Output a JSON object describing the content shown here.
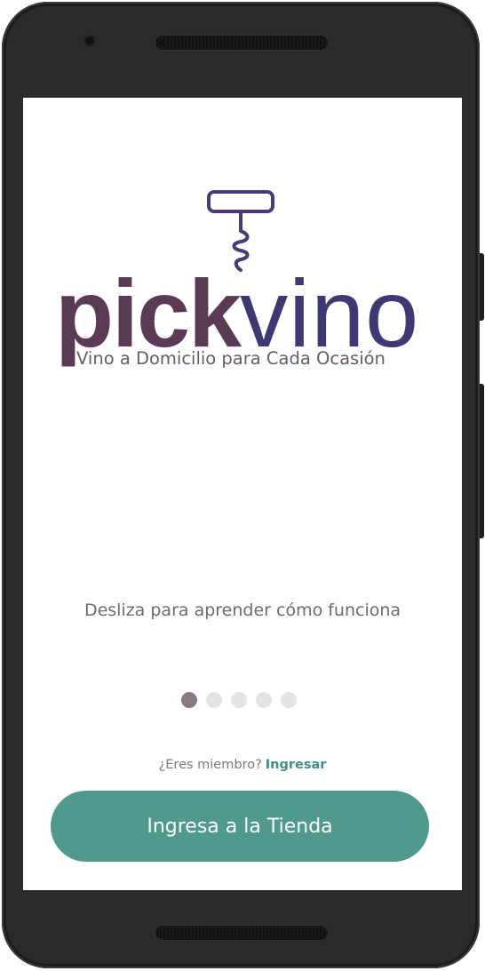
{
  "brand": {
    "logo_text_pick": "pick",
    "logo_text_vino": "vino",
    "tagline": "Vino a Domicilio para Cada Ocasión",
    "colors": {
      "pick": "#5a3a55",
      "vino": "#3e3873",
      "accent": "#4f998d",
      "link": "#3f8f82"
    },
    "icon": "corkscrew-icon"
  },
  "onboarding": {
    "swipe_hint": "Desliza para aprender cómo funciona",
    "pager": {
      "total": 5,
      "active_index": 0
    }
  },
  "auth": {
    "member_question": "¿Eres miembro?",
    "login_link": "Ingresar"
  },
  "cta": {
    "label": "Ingresa a la Tienda"
  }
}
